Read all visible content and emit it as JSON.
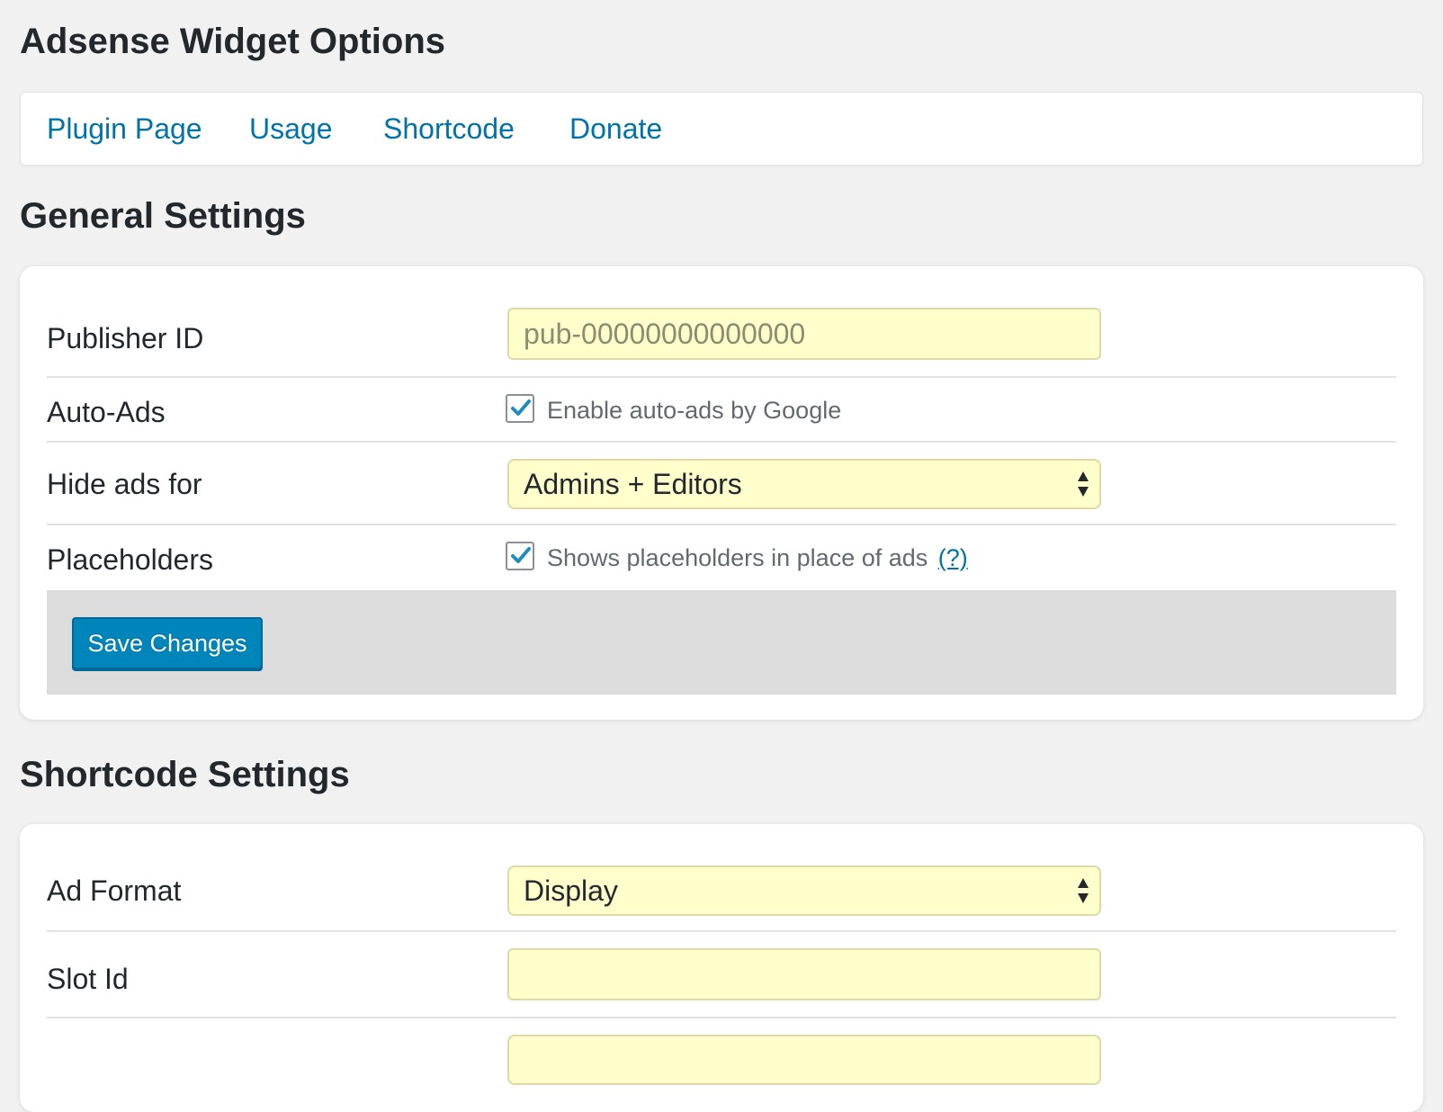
{
  "page": {
    "title": "Adsense Widget Options"
  },
  "nav": {
    "items": [
      {
        "label": "Plugin Page"
      },
      {
        "label": "Usage"
      },
      {
        "label": "Shortcode"
      },
      {
        "label": "Donate"
      }
    ]
  },
  "general": {
    "title": "General Settings",
    "publisher_id": {
      "label": "Publisher ID",
      "placeholder": "pub-00000000000000",
      "value": ""
    },
    "auto_ads": {
      "label": "Auto-Ads",
      "checkbox_label": "Enable auto-ads by Google",
      "checked": true
    },
    "hide_ads": {
      "label": "Hide ads for",
      "selected": "Admins + Editors"
    },
    "placeholders": {
      "label": "Placeholders",
      "checkbox_label": "Shows placeholders in place of ads",
      "help_link": "(?)",
      "checked": true
    },
    "save_label": "Save Changes"
  },
  "shortcode": {
    "title": "Shortcode Settings",
    "ad_format": {
      "label": "Ad Format",
      "selected": "Display"
    },
    "slot_id": {
      "label": "Slot Id",
      "value": ""
    }
  },
  "colors": {
    "link": "#0073aa",
    "field_bg": "#ffffcc",
    "button": "#0085ba",
    "page_bg": "#f1f1f1"
  }
}
